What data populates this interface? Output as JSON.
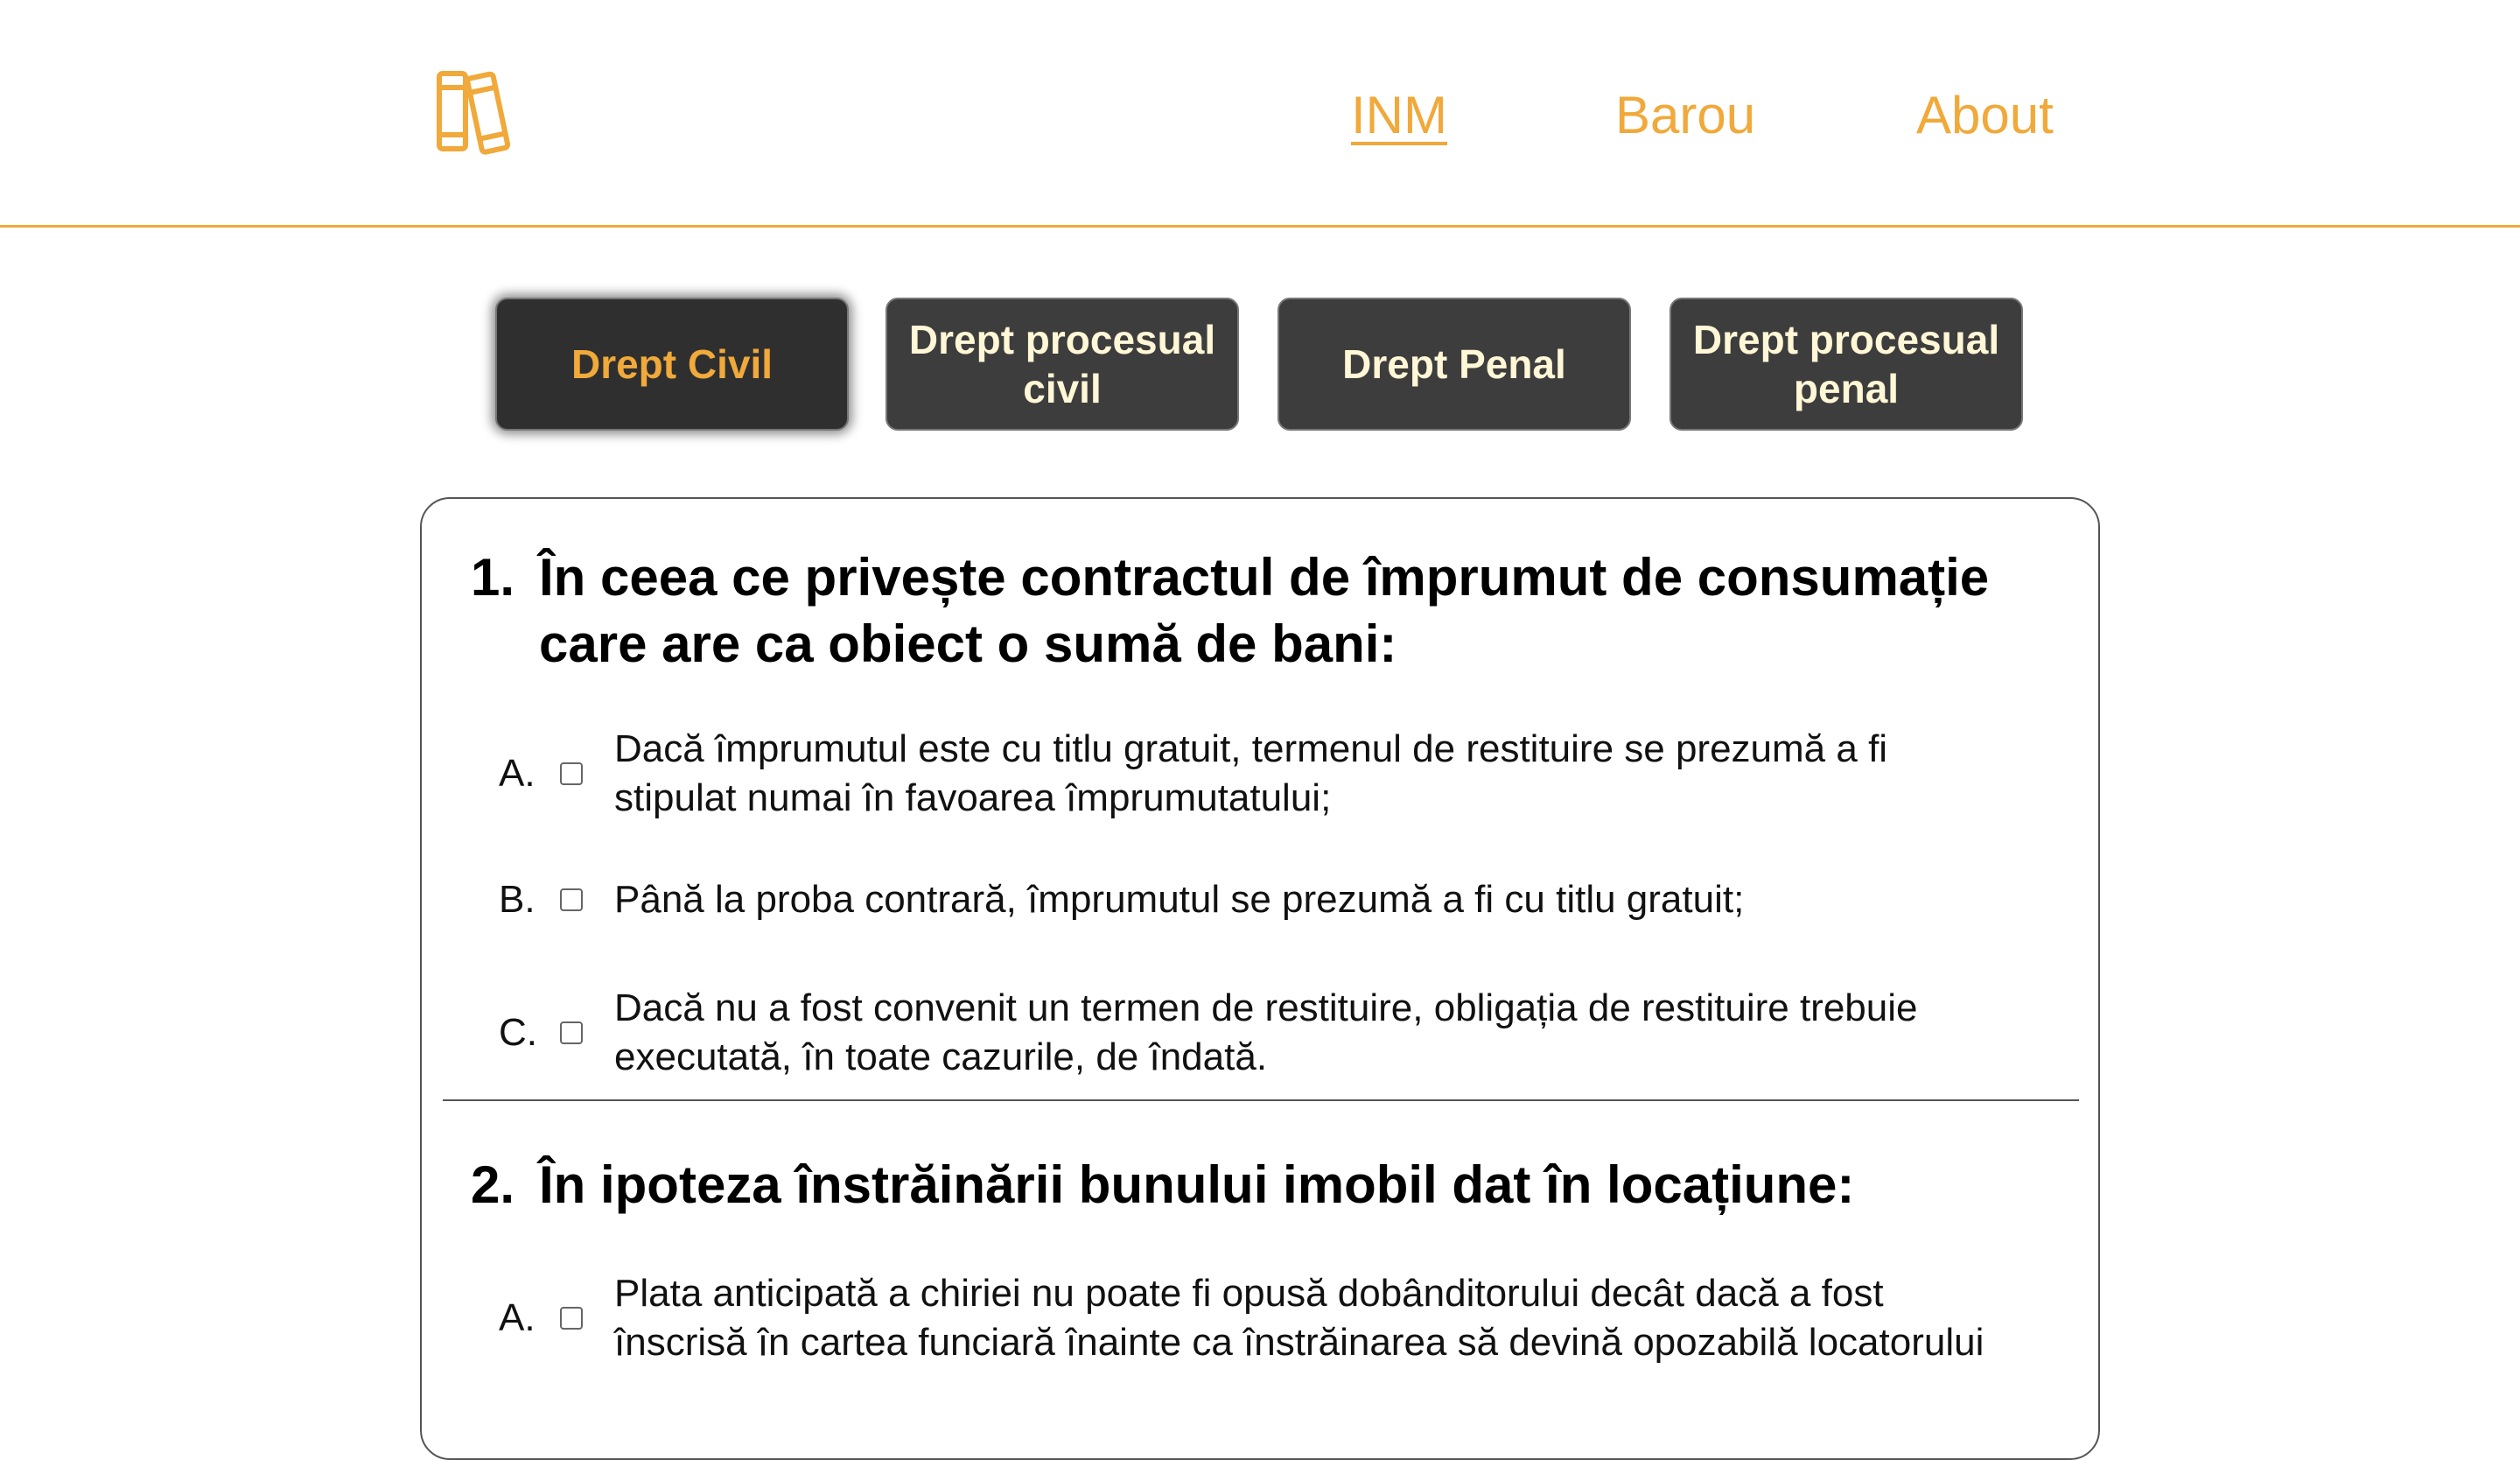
{
  "nav": {
    "links": [
      {
        "label": "INM"
      },
      {
        "label": "Barou"
      },
      {
        "label": "About"
      }
    ],
    "accent_color": "#f0a93a",
    "logo_icon": "books-icon"
  },
  "tabs": [
    {
      "label": "Drept Civil",
      "active": true
    },
    {
      "label": "Drept procesual civil",
      "active": false
    },
    {
      "label": "Drept Penal",
      "active": false
    },
    {
      "label": "Drept procesual penal",
      "active": false
    }
  ],
  "questions": [
    {
      "number": "1.",
      "text": "În ceea ce privește contractul de împrumut de consumație care are ca obiect o sumă de bani:",
      "options": [
        {
          "letter": "A.",
          "text": "Dacă împrumutul este cu titlu gratuit, termenul de restituire se prezumă a fi stipulat numai în favoarea împrumutatului;"
        },
        {
          "letter": "B.",
          "text": "Până la proba contrară, împrumutul se prezumă a fi cu titlu gratuit;"
        },
        {
          "letter": "C.",
          "text": "Dacă nu a fost convenit un termen de restituire, obligația de restituire trebuie executată, în toate cazurile, de îndată."
        }
      ]
    },
    {
      "number": "2.",
      "text": "În ipoteza înstrăinării bunului imobil dat în locațiune:",
      "options": [
        {
          "letter": "A.",
          "text": "Plata anticipată a chiriei nu poate fi opusă dobânditorului decât dacă a fost înscrisă în cartea funciară înainte ca înstrăinarea să devină opozabilă locatorului"
        }
      ]
    }
  ]
}
